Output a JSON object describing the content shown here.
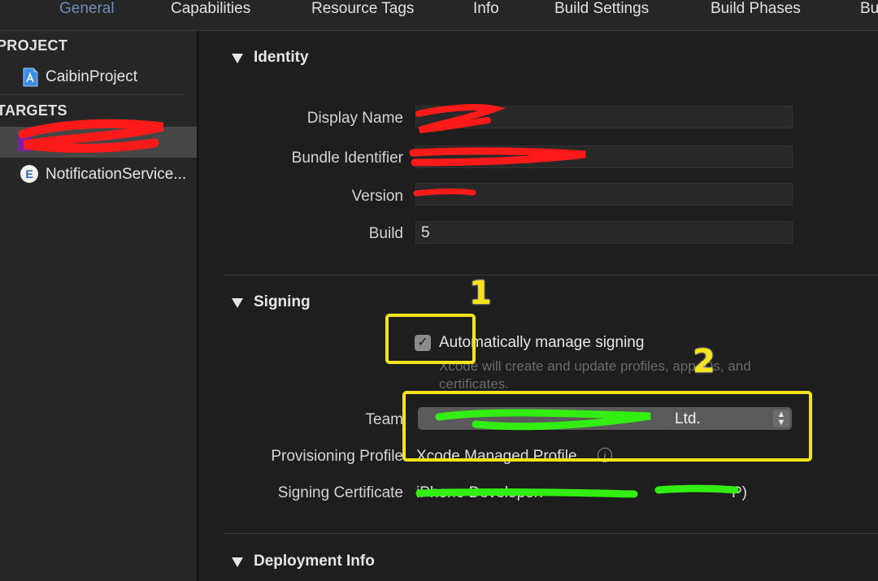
{
  "tabs": [
    {
      "label": "General",
      "active": true
    },
    {
      "label": "Capabilities"
    },
    {
      "label": "Resource Tags"
    },
    {
      "label": "Info"
    },
    {
      "label": "Build Settings"
    },
    {
      "label": "Build Phases"
    },
    {
      "label": "Bu"
    }
  ],
  "sidebar": {
    "project_header": "PROJECT",
    "project_item": "CaibinProject",
    "targets_header": "TARGETS",
    "targets": [
      {
        "label": "",
        "selected": true,
        "note": "redacted"
      },
      {
        "label": "NotificationService..."
      }
    ]
  },
  "identity": {
    "title": "Identity",
    "display_name_label": "Display Name",
    "bundle_identifier_label": "Bundle Identifier",
    "version_label": "Version",
    "build_label": "Build",
    "build_value": "5"
  },
  "signing": {
    "title": "Signing",
    "auto_manage_label": "Automatically manage signing",
    "auto_manage_checked": true,
    "help_text": "Xcode will create and update profiles, app IDs, and certificates.",
    "team_label": "Team",
    "team_value": "Ltd.",
    "provisioning_label": "Provisioning Profile",
    "provisioning_value": "Xcode Managed Profile",
    "certificate_label": "Signing Certificate",
    "certificate_value": "iPhone Developer:",
    "certificate_suffix": "P)"
  },
  "deployment": {
    "title": "Deployment Info"
  },
  "annotations": {
    "one": "1",
    "two": "2"
  },
  "colors": {
    "accent_tab": "#6e8cb6",
    "annotation": "#f7e31a",
    "redaction_red": "#ff1a1a",
    "redaction_green": "#33ee11"
  }
}
